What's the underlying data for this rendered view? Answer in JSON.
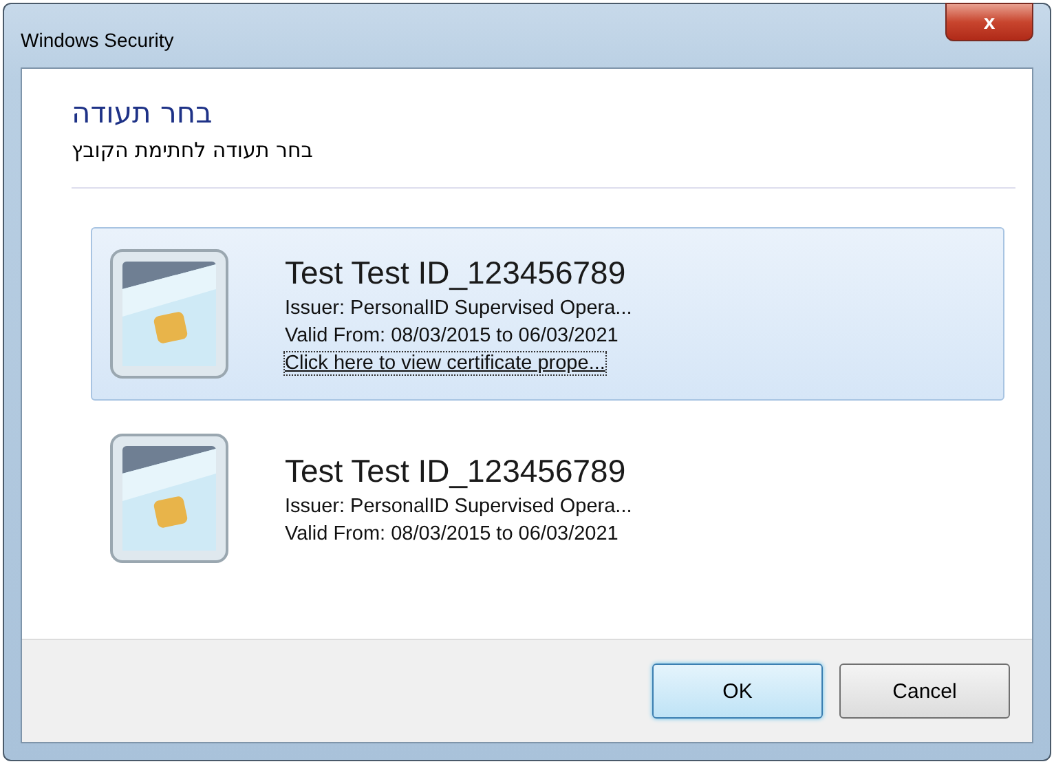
{
  "window": {
    "title": "Windows Security",
    "close": "x"
  },
  "heading": "בחר תעודה",
  "subheading": "בחר תעודה לחתימת הקובץ",
  "certificates": [
    {
      "name": "Test Test ID_123456789",
      "issuer": "Issuer: PersonalID Supervised Opera...",
      "valid": "Valid From: 08/03/2015 to 06/03/2021",
      "link": "Click here to view certificate prope...",
      "selected": true
    },
    {
      "name": "Test Test ID_123456789",
      "issuer": "Issuer: PersonalID Supervised Opera...",
      "valid": "Valid From: 08/03/2015 to 06/03/2021",
      "selected": false
    }
  ],
  "buttons": [
    {
      "label": "OK",
      "default": true
    },
    {
      "label": "Cancel",
      "default": false
    }
  ]
}
